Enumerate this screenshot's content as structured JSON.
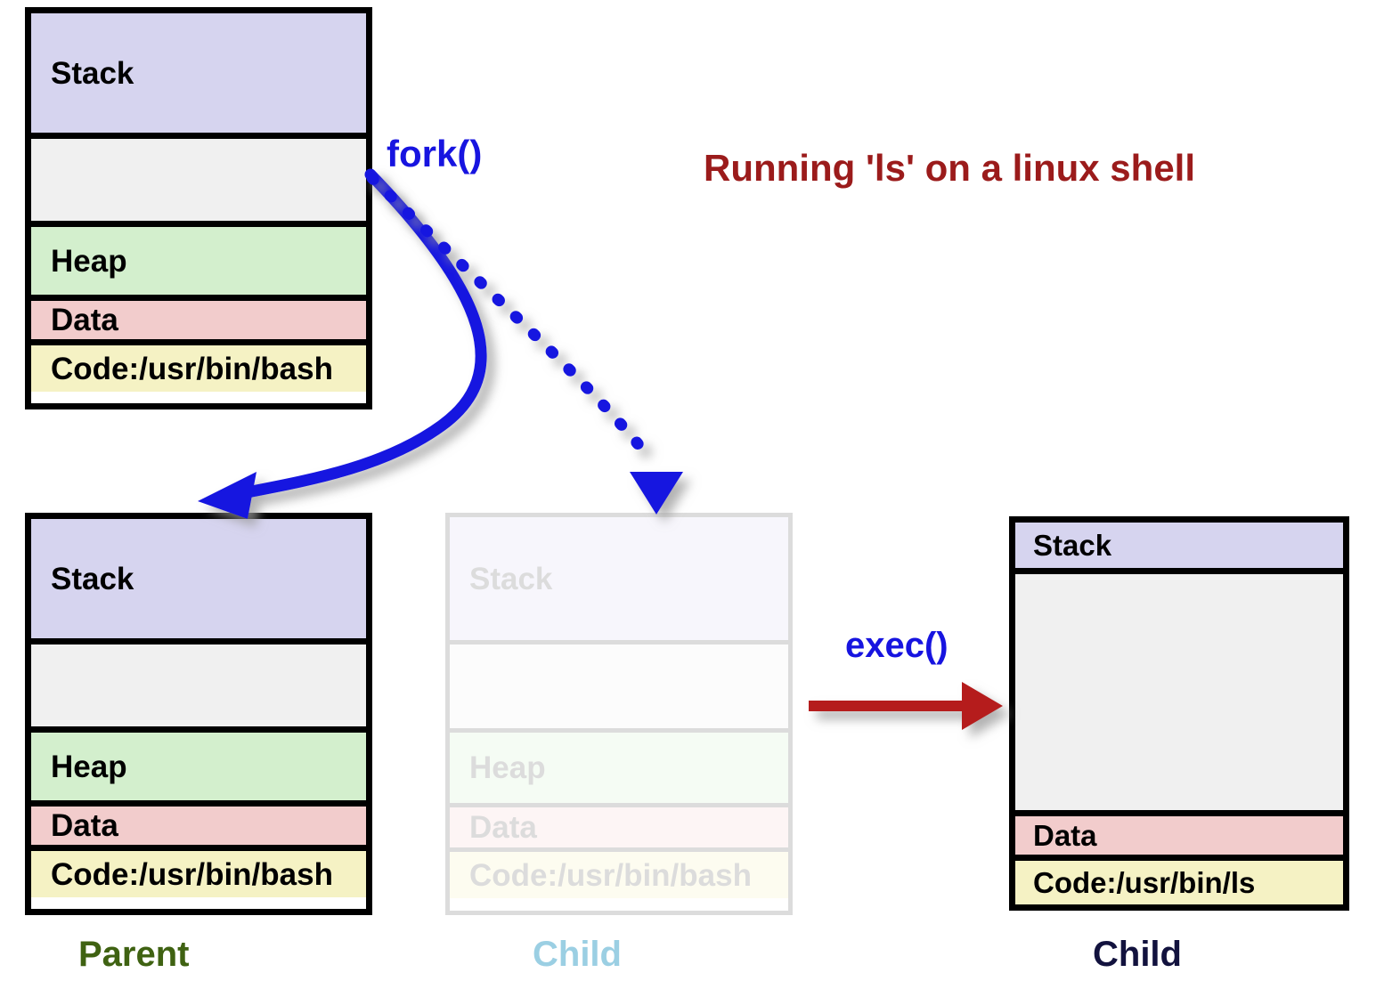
{
  "title": "Running 'ls' on a linux shell",
  "labels": {
    "fork": "fork()",
    "exec": "exec()"
  },
  "colors": {
    "stack": "#d6d4ef",
    "empty": "#f0f0f0",
    "heap": "#d3efcd",
    "data": "#f2cccc",
    "code": "#f5f2c4",
    "border": "#000000",
    "faded_border": "#dcdcdc",
    "fork_arrow": "#1714e0",
    "exec_arrow": "#b51a1a",
    "title_text": "#9b1b1b",
    "call_label_text": "#1714e0",
    "parent_caption": "#3f6212",
    "child_faded_caption": "#9bcfe3",
    "child_exec_caption": "#12123e"
  },
  "blocks": {
    "top": {
      "caption": "",
      "segments": [
        {
          "label": "Stack",
          "fill": "stack"
        },
        {
          "label": "",
          "fill": "empty"
        },
        {
          "label": "Heap",
          "fill": "heap"
        },
        {
          "label": "Data",
          "fill": "data"
        },
        {
          "label": "Code:/usr/bin/bash",
          "fill": "code"
        }
      ]
    },
    "parent": {
      "caption": "Parent",
      "segments": [
        {
          "label": "Stack",
          "fill": "stack"
        },
        {
          "label": "",
          "fill": "empty"
        },
        {
          "label": "Heap",
          "fill": "heap"
        },
        {
          "label": "Data",
          "fill": "data"
        },
        {
          "label": "Code:/usr/bin/bash",
          "fill": "code"
        }
      ]
    },
    "child_faded": {
      "caption": "Child",
      "segments": [
        {
          "label": "Stack",
          "fill": "stack"
        },
        {
          "label": "",
          "fill": "empty"
        },
        {
          "label": "Heap",
          "fill": "heap"
        },
        {
          "label": "Data",
          "fill": "data"
        },
        {
          "label": "Code:/usr/bin/bash",
          "fill": "code"
        }
      ]
    },
    "child_exec": {
      "caption": "Child",
      "segments": [
        {
          "label": "Stack",
          "fill": "stack"
        },
        {
          "label": "",
          "fill": "empty"
        },
        {
          "label": "Data",
          "fill": "data"
        },
        {
          "label": "Code:/usr/bin/ls",
          "fill": "code"
        }
      ]
    }
  }
}
